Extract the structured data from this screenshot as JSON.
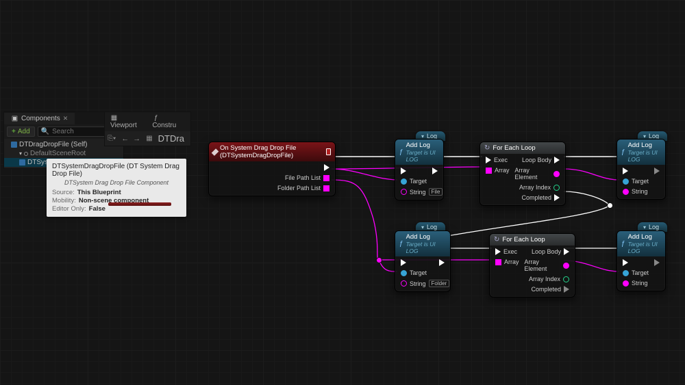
{
  "components": {
    "panel_title": "Components",
    "add_label": "Add",
    "search_placeholder": "Search",
    "root": "DTDragDropFile (Self)",
    "child_scene": "DefaultSceneRoot",
    "child_comp": "DTSystemDragDropFile"
  },
  "toolbar": {
    "viewport_tab": "Viewport",
    "construct_tab": "Constru",
    "breadcrumb": "DTDra"
  },
  "tooltip": {
    "title": "DTSystemDragDropFile (DT System Drag Drop File)",
    "subtitle": "DTSystem Drag Drop File Component",
    "source_k": "Source:",
    "source_v": "This Blueprint",
    "mobility_k": "Mobility:",
    "mobility_v": "Non-scene component",
    "editor_k": "Editor Only:",
    "editor_v": "False"
  },
  "event_node": {
    "title": "On System Drag Drop File (DTSystemDragDropFile)",
    "out_file": "File Path List",
    "out_folder": "Folder Path List"
  },
  "addlog": {
    "title": "Add Log",
    "subtitle": "Target is UI LOG",
    "target": "Target",
    "string": "String",
    "pill_file": "File",
    "pill_folder": "Folder"
  },
  "foreach": {
    "title": "For Each Loop",
    "exec": "Exec",
    "array": "Array",
    "loopbody": "Loop Body",
    "arrayelem": "Array Element",
    "arrayidx": "Array Index",
    "completed": "Completed"
  },
  "tab_label": "Log"
}
